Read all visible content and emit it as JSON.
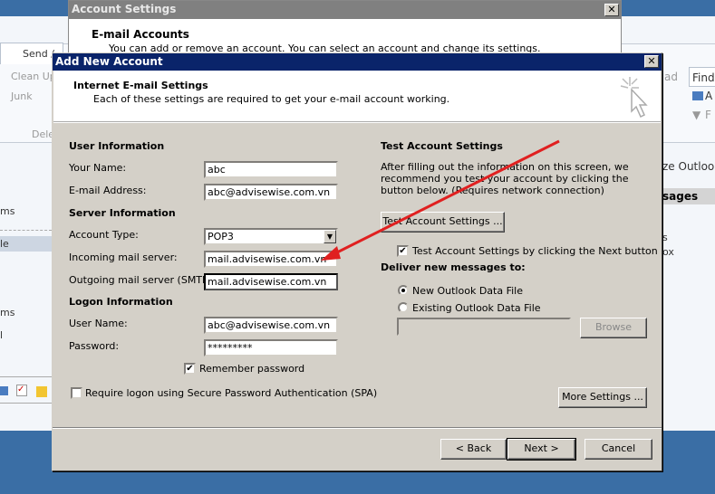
{
  "outlook": {
    "ribbon_tab": "Send /",
    "clean_up": "Clean Up",
    "junk": "Junk",
    "delete_group": "Dele",
    "read_group": "ad",
    "find_label": "Find",
    "address_book": "A",
    "filter": "F",
    "customize": "ze Outlook T",
    "messages_header": "sages",
    "left_items": [
      "ms",
      "le",
      "ms",
      "l"
    ],
    "right_items": [
      "s",
      "ox"
    ]
  },
  "account_settings": {
    "title": "Account Settings",
    "heading": "E-mail Accounts",
    "desc": "You can add or remove an account. You can select an account and change its settings."
  },
  "dialog": {
    "title": "Add New Account",
    "header_title": "Internet E-mail Settings",
    "header_desc": "Each of these settings are required to get your e-mail account working.",
    "user_info": "User Information",
    "your_name_label": "Your Name:",
    "your_name": "abc",
    "email_label": "E-mail Address:",
    "email": "abc@advisewise.com.vn",
    "server_info": "Server Information",
    "account_type_label": "Account Type:",
    "account_type": "POP3",
    "incoming_label": "Incoming mail server:",
    "incoming": "mail.advisewise.com.vn",
    "outgoing_label": "Outgoing mail server (SMTP):",
    "outgoing": "mail.advisewise.com.vn",
    "logon_info": "Logon Information",
    "username_label": "User Name:",
    "username": "abc@advisewise.com.vn",
    "password_label": "Password:",
    "password": "*********",
    "remember_password": "Remember password",
    "remember_checked": true,
    "spa": "Require logon using Secure Password Authentication (SPA)",
    "spa_checked": false,
    "test_title": "Test Account Settings",
    "test_desc": "After filling out the information on this screen, we recommend you test your account by clicking the button below. (Requires network connection)",
    "test_button": "Test Account Settings ...",
    "test_next": "Test Account Settings by clicking the Next button",
    "test_next_checked": true,
    "deliver_title": "Deliver new messages to:",
    "new_data_file": "New Outlook Data File",
    "existing_data_file": "Existing Outlook Data File",
    "existing_path": "",
    "browse": "Browse",
    "more_settings": "More Settings ...",
    "back": "< Back",
    "next": "Next >",
    "cancel": "Cancel"
  },
  "colors": {
    "annotation_arrow": "#e02020",
    "title_bar": "#0a246a",
    "desktop": "#3a6ea5"
  }
}
